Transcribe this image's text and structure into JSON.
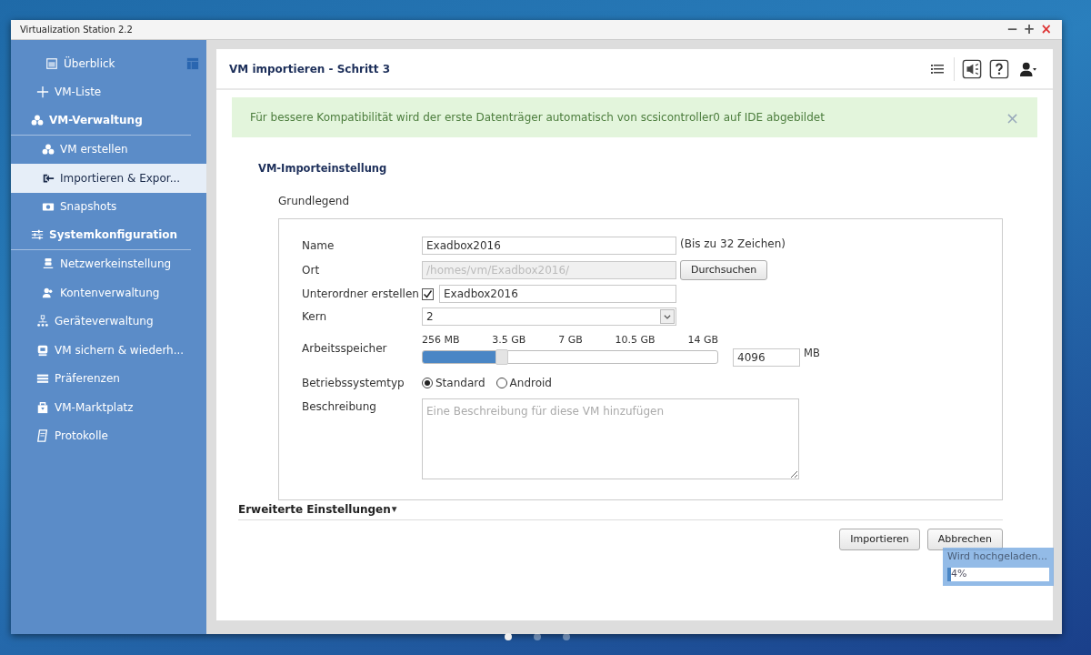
{
  "window": {
    "title": "Virtualization Station 2.2",
    "controls": [
      "−",
      "+",
      "×"
    ]
  },
  "sidebar": {
    "items": [
      {
        "kind": "item",
        "label": "Überblick",
        "selected": false
      },
      {
        "kind": "item",
        "label": "VM-Liste",
        "selected": false
      },
      {
        "kind": "group",
        "label": "VM-Verwaltung",
        "selected": false,
        "children": [
          {
            "label": "VM erstellen",
            "selected": false
          },
          {
            "label": "Importieren & Expor...",
            "selected": true
          },
          {
            "label": "Snapshots",
            "selected": false
          }
        ]
      },
      {
        "kind": "group",
        "label": "Systemkonfiguration",
        "selected": false,
        "children": [
          {
            "label": "Netzwerkeinstellung",
            "selected": false
          },
          {
            "label": "Kontenverwaltung",
            "selected": false
          }
        ]
      },
      {
        "kind": "item",
        "label": "Geräteverwaltung",
        "selected": false
      },
      {
        "kind": "item",
        "label": "VM sichern & wiederh...",
        "selected": false
      },
      {
        "kind": "item",
        "label": "Präferenzen",
        "selected": false
      },
      {
        "kind": "item",
        "label": "VM-Marktplatz",
        "selected": false
      },
      {
        "kind": "item",
        "label": "Protokolle",
        "selected": false
      }
    ]
  },
  "header": {
    "title": "VM importieren - Schritt 3"
  },
  "alert": {
    "text": "Für bessere Kompatibilität wird der erste Datenträger automatisch von scsicontroller0 auf IDE abgebildet",
    "close": "×"
  },
  "section": {
    "title": "VM-Importeinstellung",
    "subtitle": "Grundlegend",
    "fields": [
      {
        "kind": "text",
        "label": "Name",
        "value": "Exadbox2016",
        "hint": "(Bis zu 32 Zeichen)"
      },
      {
        "kind": "path",
        "label": "Ort",
        "value": "/homes/vm/Exadbox2016/",
        "disabled": true,
        "button": "Durchsuchen"
      },
      {
        "kind": "check",
        "label": "Unterordner erstellen",
        "checked": true,
        "value": "Exadbox2016"
      },
      {
        "kind": "select",
        "label": "Kern",
        "value": "2"
      },
      {
        "kind": "slider",
        "label": "Arbeitsspeicher",
        "ticks": [
          "256 MB",
          "3.5 GB",
          "7 GB",
          "10.5 GB",
          "14 GB"
        ],
        "level": 0.27,
        "value": "4096",
        "unit": "MB"
      },
      {
        "kind": "radio",
        "label": "Betriebssystemtyp",
        "options": [
          {
            "label": "Standard",
            "selected": true
          },
          {
            "label": "Android",
            "selected": false
          }
        ]
      },
      {
        "kind": "textarea",
        "label": "Beschreibung",
        "placeholder": "Eine Beschreibung für diese VM hinzufügen"
      }
    ]
  },
  "advanced": {
    "label": "Erweiterte Einstellungen",
    "arrow": "▾"
  },
  "buttons": [
    "Importieren",
    "Abbrechen"
  ],
  "upload": {
    "label": "Wird hochgeladen...",
    "level": 0.04,
    "reading": "4%"
  },
  "pager": [
    {
      "selected": true
    },
    {
      "selected": false
    },
    {
      "selected": false
    }
  ]
}
